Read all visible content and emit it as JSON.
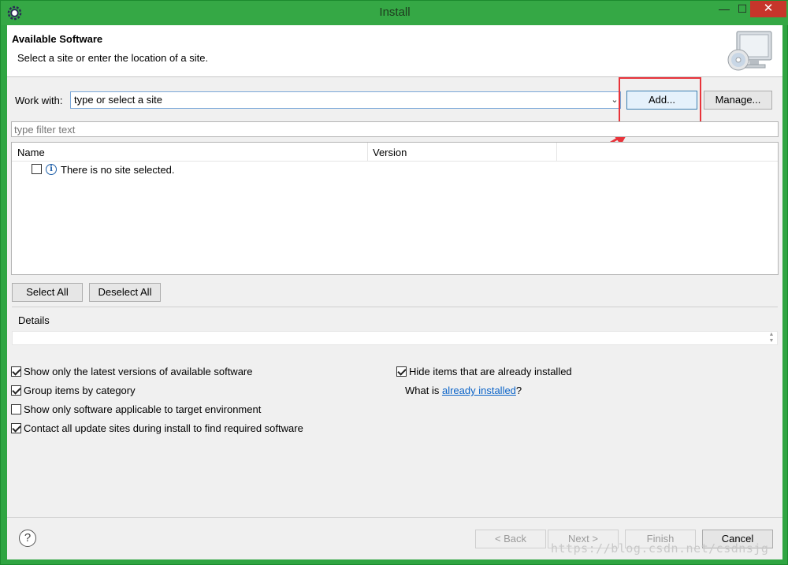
{
  "window": {
    "title": "Install",
    "minimize_glyph": "—",
    "maximize_glyph": "☐",
    "close_glyph": "✕"
  },
  "header": {
    "title": "Available Software",
    "description": "Select a site or enter the location of a site."
  },
  "work_with": {
    "label": "Work with:",
    "value": "type or select a site",
    "add_label": "Add...",
    "manage_label": "Manage..."
  },
  "filter": {
    "placeholder": "type filter text"
  },
  "tree": {
    "columns": [
      "Name",
      "Version"
    ],
    "rows": [
      {
        "text": "There is no site selected.",
        "checked": false,
        "icon": "info-icon"
      }
    ]
  },
  "selection": {
    "select_all_label": "Select All",
    "deselect_all_label": "Deselect All"
  },
  "details": {
    "label": "Details"
  },
  "options": {
    "show_latest": {
      "label": "Show only the latest versions of available software",
      "checked": true
    },
    "group_by_category": {
      "label": "Group items by category",
      "checked": true
    },
    "show_applicable": {
      "label": "Show only software applicable to target environment",
      "checked": false
    },
    "contact_all_sites": {
      "label": "Contact all update sites during install to find required software",
      "checked": true
    },
    "hide_installed": {
      "label": "Hide items that are already installed",
      "checked": true
    },
    "what_is_prefix": "What is ",
    "what_is_link": "already installed",
    "what_is_suffix": "?"
  },
  "footer": {
    "help_glyph": "?",
    "back_label": "< Back",
    "next_label": "Next >",
    "finish_label": "Finish",
    "cancel_label": "Cancel"
  },
  "watermark": "https://blog.csdn.net/csdnsjg",
  "colors": {
    "titlebar": "#35a845",
    "close_button": "#c7352b",
    "highlight": "#e8333a",
    "link": "#0a63c8"
  }
}
